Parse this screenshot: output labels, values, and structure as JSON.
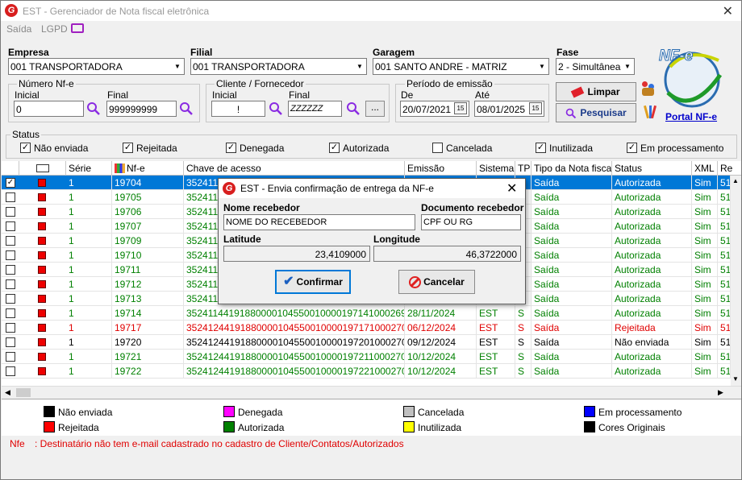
{
  "window": {
    "title": "EST - Gerenciador de Nota fiscal eletrônica",
    "app_logo": "G"
  },
  "menu": {
    "items": [
      "Saída",
      "LGPD"
    ]
  },
  "filters": {
    "empresa": {
      "label": "Empresa",
      "value": "001 TRANSPORTADORA"
    },
    "filial": {
      "label": "Filial",
      "value": "001 TRANSPORTADORA"
    },
    "garagem": {
      "label": "Garagem",
      "value": "001 SANTO ANDRE - MATRIZ"
    },
    "fase": {
      "label": "Fase",
      "value": "2 - Simultânea"
    },
    "numero_nfe": {
      "title": "Número Nf-e",
      "inicial_label": "Inicial",
      "inicial": "0",
      "final_label": "Final",
      "final": "999999999"
    },
    "cliente": {
      "title": "Cliente / Fornecedor",
      "inicial_label": "Inicial",
      "inicial": "!",
      "final_label": "Final",
      "final": "ZZZZZZ",
      "more": "..."
    },
    "periodo": {
      "title": "Período de emissão",
      "de_label": "De",
      "de": "20/07/2021",
      "ate_label": "Até",
      "ate": "08/01/2025",
      "cal": "15"
    }
  },
  "buttons": {
    "limpar": "Limpar",
    "pesquisar": "Pesquisar",
    "portal": "Portal NF-e"
  },
  "nfe_logo": {
    "text": "NF-e"
  },
  "status_filter": {
    "title": "Status",
    "items": [
      {
        "label": "Não enviada",
        "checked": true
      },
      {
        "label": "Rejeitada",
        "checked": true
      },
      {
        "label": "Denegada",
        "checked": true
      },
      {
        "label": "Autorizada",
        "checked": true
      },
      {
        "label": "Cancelada",
        "checked": false
      },
      {
        "label": "Inutilizada",
        "checked": true
      },
      {
        "label": "Em processamento",
        "checked": true
      }
    ]
  },
  "grid": {
    "columns": [
      "",
      "",
      "Série",
      "Nf-e",
      "Chave de acesso",
      "Emissão",
      "Sistema",
      "TP",
      "Tipo da Nota fiscal",
      "Status",
      "XML",
      "Re"
    ],
    "rows": [
      {
        "checked": true,
        "serie": "1",
        "nfe": "19704",
        "chave": "352411441918800001045500100001970...",
        "emissao": "",
        "sistema": "",
        "tp": "",
        "tipo": "Saída",
        "status": "Autorizada",
        "xml": "Sim",
        "re": "51",
        "color": "#008000",
        "selected": true
      },
      {
        "checked": false,
        "serie": "1",
        "nfe": "19705",
        "chave": "35241144",
        "emissao": "",
        "sistema": "",
        "tp": "",
        "tipo": "Saída",
        "status": "Autorizada",
        "xml": "Sim",
        "re": "51",
        "color": "#008000"
      },
      {
        "checked": false,
        "serie": "1",
        "nfe": "19706",
        "chave": "35241144",
        "emissao": "",
        "sistema": "",
        "tp": "",
        "tipo": "Saída",
        "status": "Autorizada",
        "xml": "Sim",
        "re": "51",
        "color": "#008000"
      },
      {
        "checked": false,
        "serie": "1",
        "nfe": "19707",
        "chave": "35241144",
        "emissao": "",
        "sistema": "",
        "tp": "",
        "tipo": "Saída",
        "status": "Autorizada",
        "xml": "Sim",
        "re": "51",
        "color": "#008000"
      },
      {
        "checked": false,
        "serie": "1",
        "nfe": "19709",
        "chave": "35241144",
        "emissao": "",
        "sistema": "",
        "tp": "",
        "tipo": "Saída",
        "status": "Autorizada",
        "xml": "Sim",
        "re": "51",
        "color": "#008000"
      },
      {
        "checked": false,
        "serie": "1",
        "nfe": "19710",
        "chave": "35241144",
        "emissao": "",
        "sistema": "",
        "tp": "",
        "tipo": "Saída",
        "status": "Autorizada",
        "xml": "Sim",
        "re": "51",
        "color": "#008000"
      },
      {
        "checked": false,
        "serie": "1",
        "nfe": "19711",
        "chave": "35241144",
        "emissao": "",
        "sistema": "",
        "tp": "",
        "tipo": "Saída",
        "status": "Autorizada",
        "xml": "Sim",
        "re": "51",
        "color": "#008000"
      },
      {
        "checked": false,
        "serie": "1",
        "nfe": "19712",
        "chave": "35241144",
        "emissao": "",
        "sistema": "",
        "tp": "",
        "tipo": "Saída",
        "status": "Autorizada",
        "xml": "Sim",
        "re": "51",
        "color": "#008000"
      },
      {
        "checked": false,
        "serie": "1",
        "nfe": "19713",
        "chave": "35241144",
        "emissao": "",
        "sistema": "",
        "tp": "",
        "tipo": "Saída",
        "status": "Autorizada",
        "xml": "Sim",
        "re": "51",
        "color": "#008000"
      },
      {
        "checked": false,
        "serie": "1",
        "nfe": "19714",
        "chave": "35241144191880000104550010000197141000269990",
        "emissao": "28/11/2024",
        "sistema": "EST",
        "tp": "S",
        "tipo": "Saída",
        "status": "Autorizada",
        "xml": "Sim",
        "re": "51",
        "color": "#008000"
      },
      {
        "checked": false,
        "serie": "1",
        "nfe": "19717",
        "chave": "35241244191880000104550010000197171000270004",
        "emissao": "06/12/2024",
        "sistema": "EST",
        "tp": "S",
        "tipo": "Saída",
        "status": "Rejeitada",
        "xml": "Sim",
        "re": "51",
        "color": "#e00000"
      },
      {
        "checked": false,
        "serie": "1",
        "nfe": "19720",
        "chave": "35241244191880000104550010000197201000270026",
        "emissao": "09/12/2024",
        "sistema": "EST",
        "tp": "S",
        "tipo": "Saída",
        "status": "Não enviada",
        "xml": "Sim",
        "re": "51",
        "color": "#000000"
      },
      {
        "checked": false,
        "serie": "1",
        "nfe": "19721",
        "chave": "35241244191880000104550010000197211000270023",
        "emissao": "10/12/2024",
        "sistema": "EST",
        "tp": "S",
        "tipo": "Saída",
        "status": "Autorizada",
        "xml": "Sim",
        "re": "51",
        "color": "#008000"
      },
      {
        "checked": false,
        "serie": "1",
        "nfe": "19722",
        "chave": "35241244191880000104550010000197221000270039",
        "emissao": "10/12/2024",
        "sistema": "EST",
        "tp": "S",
        "tipo": "Saída",
        "status": "Autorizada",
        "xml": "Sim",
        "re": "51",
        "color": "#008000"
      }
    ]
  },
  "legend": [
    {
      "label": "Não enviada",
      "color": "#000000"
    },
    {
      "label": "Denegada",
      "color": "#ff00ff"
    },
    {
      "label": "Cancelada",
      "color": "#c0c0c0"
    },
    {
      "label": "Em processamento",
      "color": "#0000ff"
    },
    {
      "label": "Rejeitada",
      "color": "#ff0000"
    },
    {
      "label": "Autorizada",
      "color": "#008000"
    },
    {
      "label": "Inutilizada",
      "color": "#ffff00"
    },
    {
      "label": "Cores Originais",
      "color": "#000000"
    }
  ],
  "footer": {
    "key": "Nfe",
    "message": ": Destinatário não tem e-mail cadastrado no cadastro de Cliente/Contatos/Autorizados"
  },
  "dialog": {
    "title": "EST - Envia confirmação de entrega da NF-e",
    "nome_label": "Nome recebedor",
    "nome_value": "NOME DO RECEBEDOR",
    "doc_label": "Documento recebedor",
    "doc_value": "CPF OU RG",
    "lat_label": "Latitude",
    "lat_value": "23,4109000",
    "lon_label": "Longitude",
    "lon_value": "46,3722000",
    "confirm": "Confirmar",
    "cancel": "Cancelar"
  }
}
